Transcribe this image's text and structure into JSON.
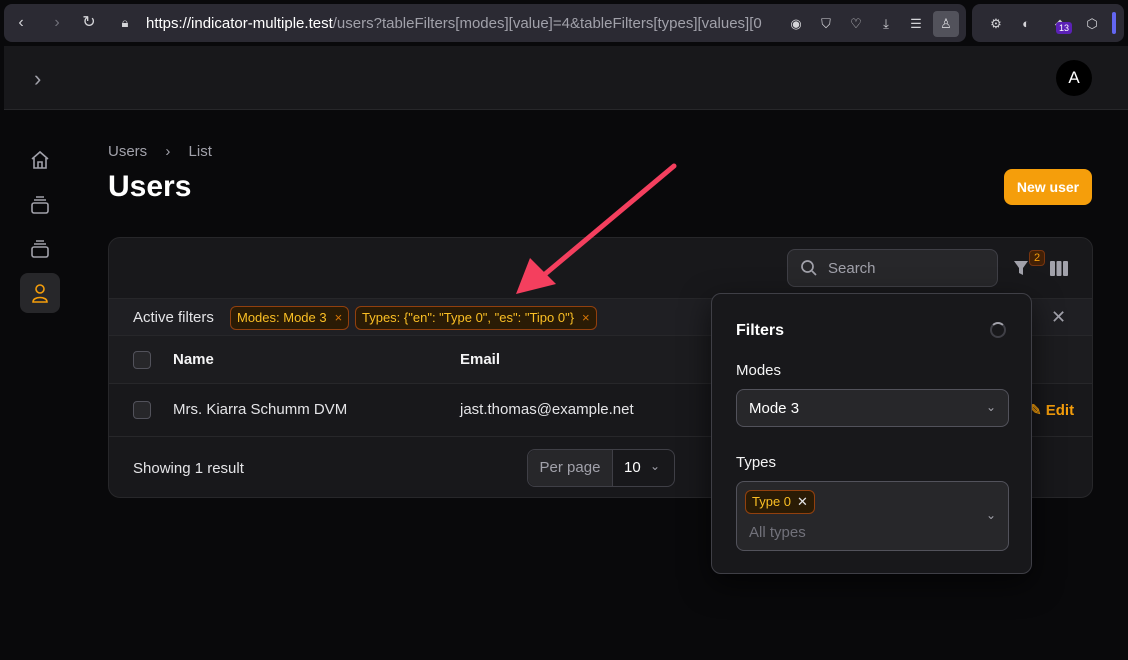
{
  "browser": {
    "url_host": "https://indicator-multiple.test",
    "url_path": "/users?tableFilters[modes][value]=4&tableFilters[types][values][0",
    "extension_badge": "13"
  },
  "topbar": {
    "avatar_initial": "A"
  },
  "breadcrumb": {
    "items": [
      "Users",
      "List"
    ]
  },
  "page": {
    "title": "Users",
    "new_button": "New user"
  },
  "toolbar": {
    "search_placeholder": "Search",
    "filter_count": "2"
  },
  "active_filters": {
    "label": "Active filters",
    "chips": [
      "Modes: Mode 3",
      "Types: {\"en\": \"Type 0\", \"es\": \"Tipo 0\"}"
    ]
  },
  "table": {
    "columns": [
      "Name",
      "Email"
    ],
    "rows": [
      {
        "name": "Mrs. Kiarra Schumm DVM",
        "email": "jast.thomas@example.net",
        "action": "Edit"
      }
    ]
  },
  "footer": {
    "showing": "Showing 1 result",
    "per_page_label": "Per page",
    "per_page_value": "10"
  },
  "filters_panel": {
    "title": "Filters",
    "modes_label": "Modes",
    "modes_value": "Mode 3",
    "types_label": "Types",
    "types_selected": "Type 0",
    "types_placeholder": "All types"
  },
  "colors": {
    "accent": "#f59e0b",
    "annotation_arrow": "#f43f5e"
  }
}
